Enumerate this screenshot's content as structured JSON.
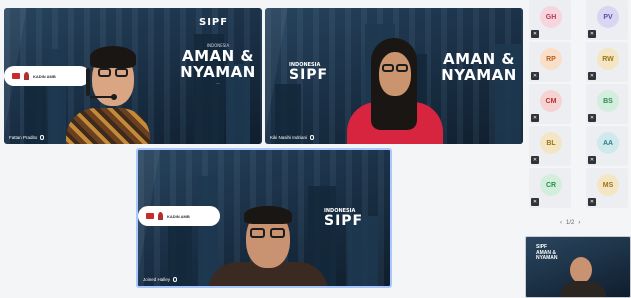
{
  "tiles": {
    "top_left": {
      "name": "Fattan Pradito",
      "banner_small": "INDONESIA",
      "banner_line1": "AMAN &",
      "banner_line2": "NYAMAN",
      "banner_sub": "—",
      "logo": "SIPF",
      "pill_text": "KADIN AMB"
    },
    "top_right": {
      "name": "Kiki Nasihi Indriani",
      "logo_small": "INDONESIA",
      "logo": "SIPF",
      "banner_line1": "AMAN &",
      "banner_line2": "NYAMAN"
    },
    "bottom_center": {
      "name": "Joined Halley",
      "pill_text": "KADIN AMB",
      "logo_small": "INDONESIA",
      "logo": "SIPF"
    }
  },
  "sidebar": {
    "participants": [
      {
        "initials": "GH",
        "color": "#f6d5dc",
        "text_color": "#b53a5a"
      },
      {
        "initials": "PV",
        "color": "#d9d5f2",
        "text_color": "#5b4fa8"
      },
      {
        "initials": "RP",
        "color": "#f9dfc7",
        "text_color": "#b7601e"
      },
      {
        "initials": "RW",
        "color": "#f4e6c4",
        "text_color": "#9c7414"
      },
      {
        "initials": "CM",
        "color": "#f6d3d3",
        "text_color": "#b33030"
      },
      {
        "initials": "BS",
        "color": "#d3eedc",
        "text_color": "#2e8a4f"
      },
      {
        "initials": "BL",
        "color": "#f4e6c4",
        "text_color": "#9c7414"
      },
      {
        "initials": "AA",
        "color": "#cfe9ec",
        "text_color": "#2a8090"
      },
      {
        "initials": "CR",
        "color": "#d3eedc",
        "text_color": "#2e8a4f"
      },
      {
        "initials": "MS",
        "color": "#f4e6c4",
        "text_color": "#9c7414"
      }
    ],
    "pager": {
      "prev": "‹",
      "label": "1/2",
      "next": "›"
    }
  },
  "thumbnail": {
    "line1": "SIPF",
    "line2": "AMAN &",
    "line3": "NYAMAN"
  },
  "colors": {
    "speaker_border": "#ffffff",
    "background": "#f4f5f7"
  }
}
